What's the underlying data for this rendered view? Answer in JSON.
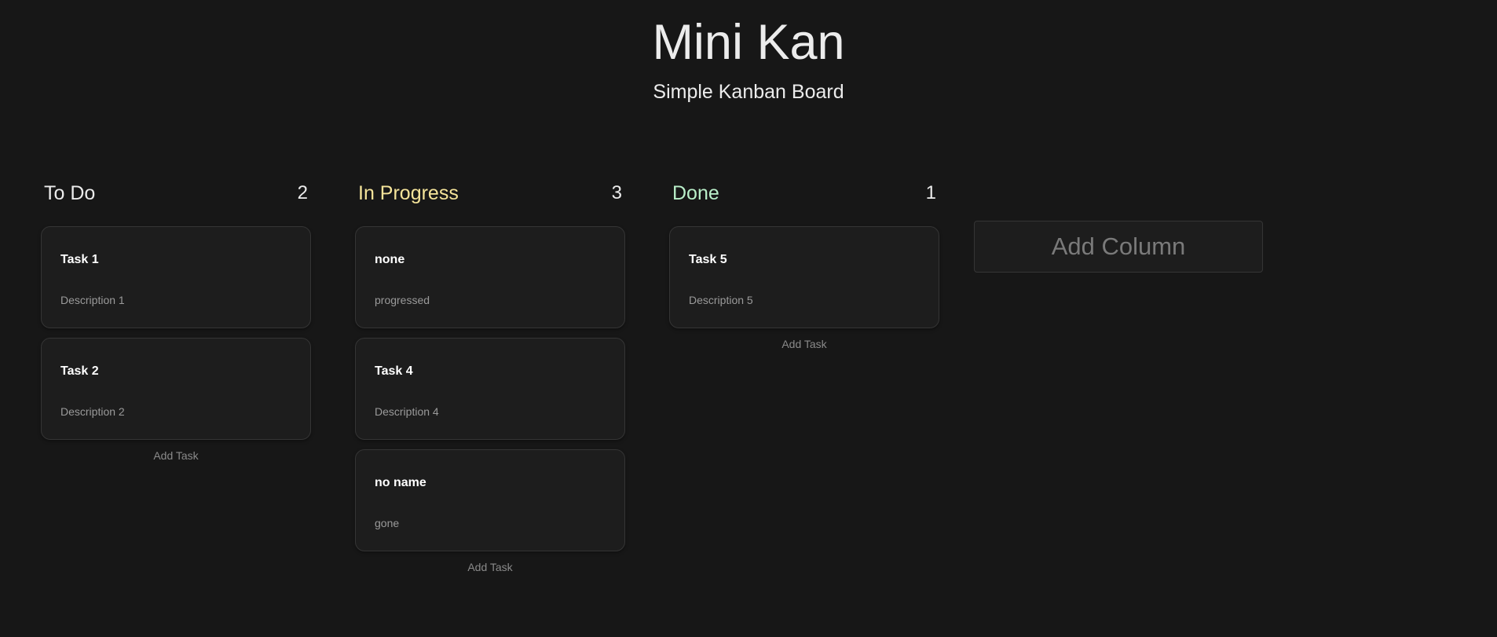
{
  "app": {
    "title": "Mini Kan",
    "subtitle": "Simple Kanban Board"
  },
  "columns": [
    {
      "title": "To Do",
      "count": "2",
      "title_color": "#ececec",
      "cards": [
        {
          "title": "Task 1",
          "description": "Description 1"
        },
        {
          "title": "Task 2",
          "description": "Description 2"
        }
      ],
      "add_task_label": "Add Task"
    },
    {
      "title": "In Progress",
      "count": "3",
      "title_color": "#f5e49a",
      "cards": [
        {
          "title": "none",
          "description": "progressed"
        },
        {
          "title": "Task 4",
          "description": "Description 4"
        },
        {
          "title": "no name",
          "description": "gone"
        }
      ],
      "add_task_label": "Add Task"
    },
    {
      "title": "Done",
      "count": "1",
      "title_color": "#b9efc9",
      "cards": [
        {
          "title": "Task 5",
          "description": "Description 5"
        }
      ],
      "add_task_label": "Add Task"
    }
  ],
  "add_column_label": "Add Column"
}
